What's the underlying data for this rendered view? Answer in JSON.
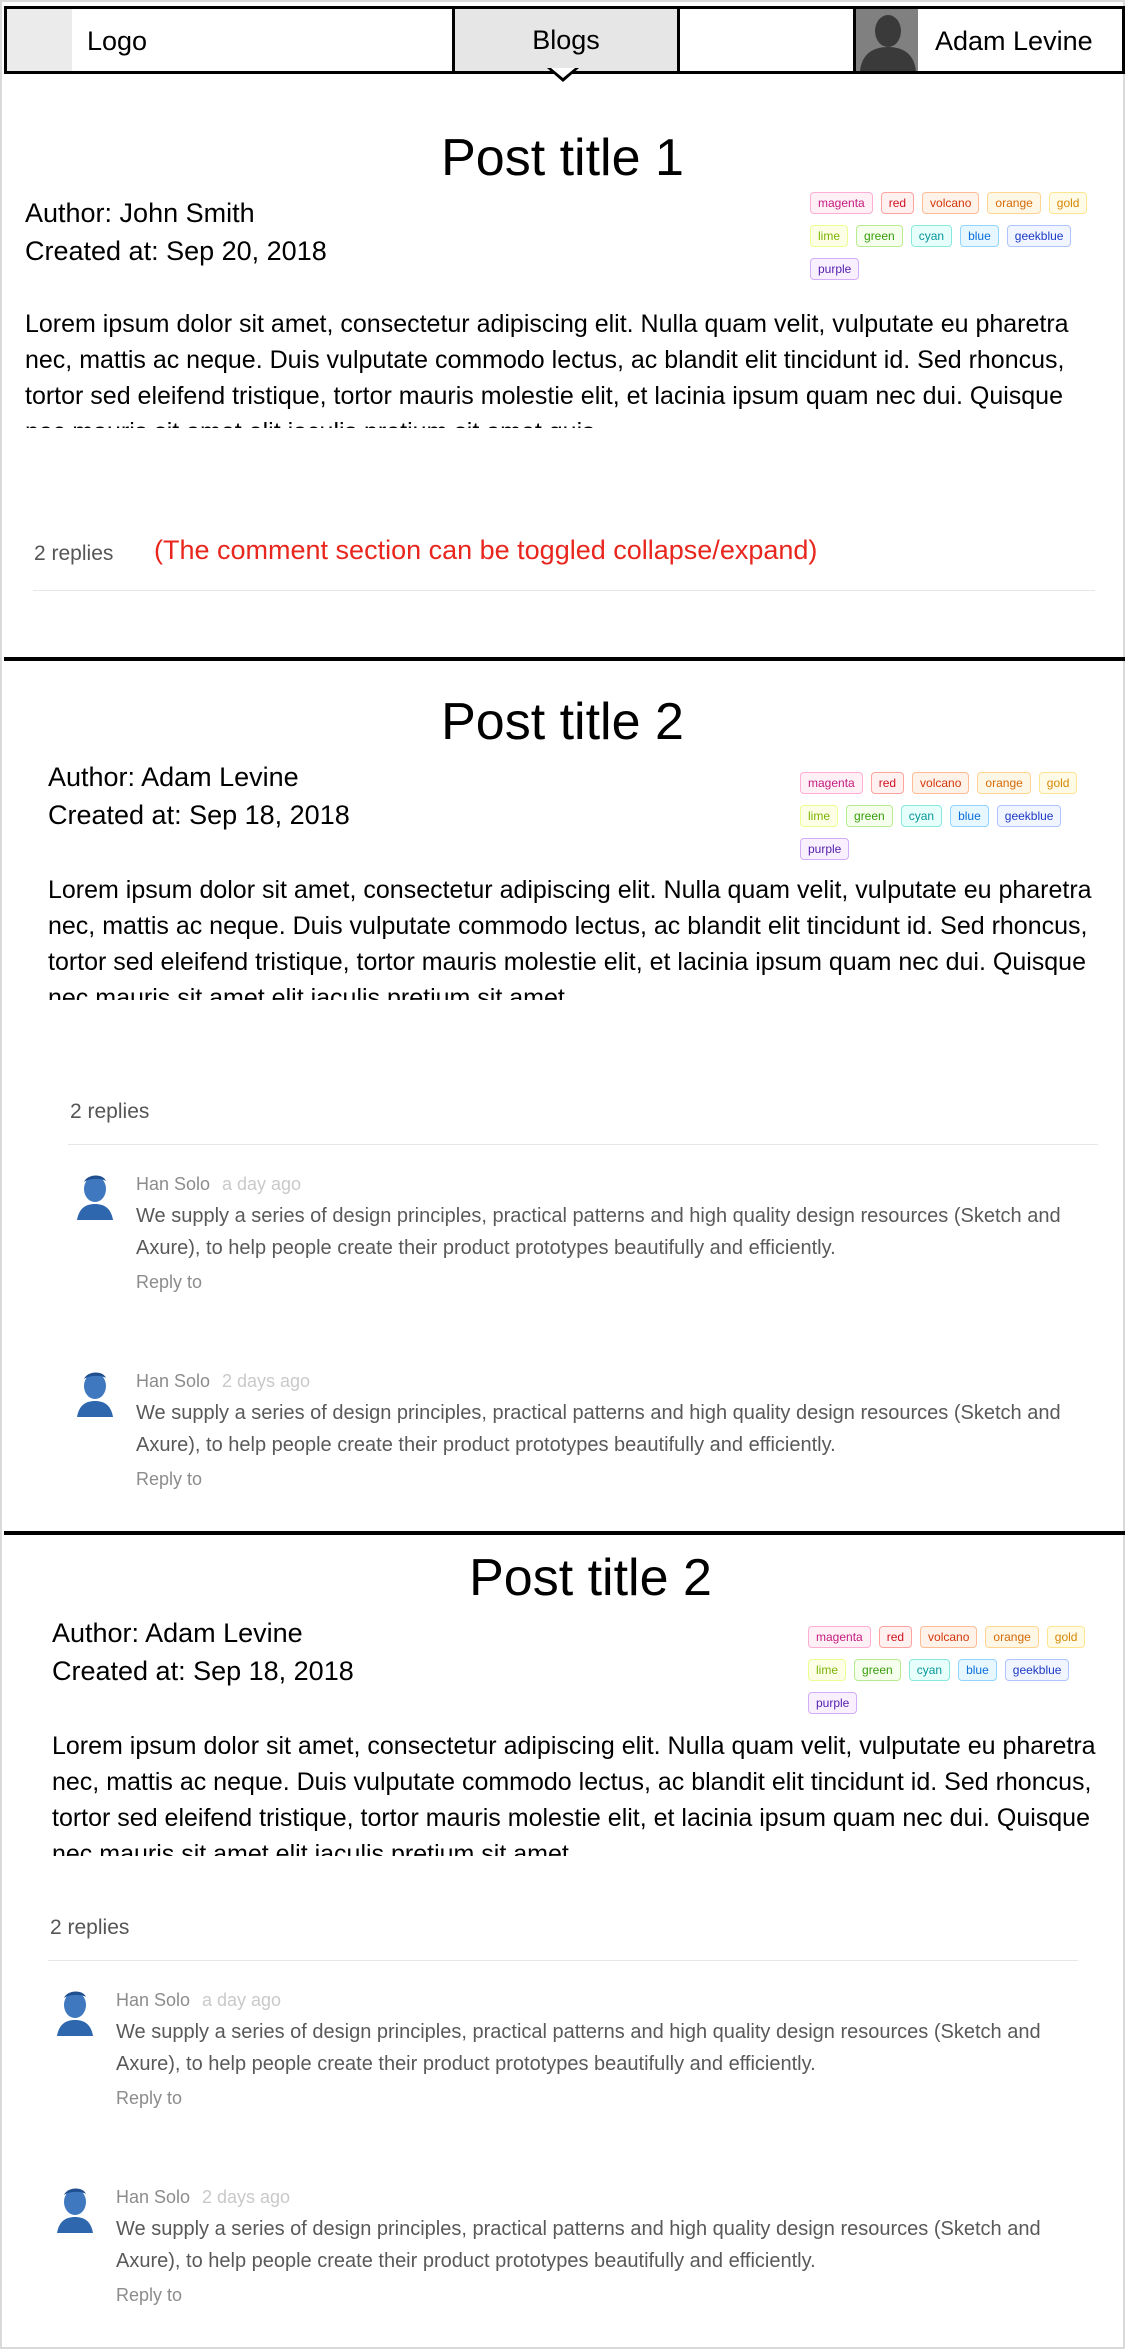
{
  "header": {
    "logo": "Logo",
    "nav_item": "Blogs",
    "user_name": "Adam Levine"
  },
  "tag_list": [
    {
      "label": "magenta",
      "color": "#c41d7f",
      "bg": "#fff0f6",
      "border": "#ffadd2"
    },
    {
      "label": "red",
      "color": "#cf1322",
      "bg": "#fff1f0",
      "border": "#ffa39e"
    },
    {
      "label": "volcano",
      "color": "#d4380d",
      "bg": "#fff2e8",
      "border": "#ffbb96"
    },
    {
      "label": "orange",
      "color": "#d46b08",
      "bg": "#fff7e6",
      "border": "#ffd591"
    },
    {
      "label": "gold",
      "color": "#d48806",
      "bg": "#fffbe6",
      "border": "#ffe58f"
    },
    {
      "label": "lime",
      "color": "#7cb305",
      "bg": "#fcffe6",
      "border": "#eaff8f"
    },
    {
      "label": "green",
      "color": "#389e0d",
      "bg": "#f6ffed",
      "border": "#b7eb8f"
    },
    {
      "label": "cyan",
      "color": "#08979c",
      "bg": "#e6fffb",
      "border": "#87e8de"
    },
    {
      "label": "blue",
      "color": "#096dd9",
      "bg": "#e6f7ff",
      "border": "#91d5ff"
    },
    {
      "label": "geekblue",
      "color": "#1d39c4",
      "bg": "#f0f5ff",
      "border": "#adc6ff"
    },
    {
      "label": "purple",
      "color": "#531dab",
      "bg": "#f9f0ff",
      "border": "#d3adf7"
    }
  ],
  "posts": [
    {
      "title": "Post title 1",
      "author": "Author: John Smith",
      "created": "Created at: Sep 20, 2018",
      "body": "Lorem ipsum dolor sit amet, consectetur adipiscing elit. Nulla quam velit, vulputate eu pharetra nec, mattis ac neque. Duis vulputate commodo lectus, ac blandit elit tincidunt id. Sed rhoncus, tortor sed eleifend tristique, tortor mauris molestie elit, et lacinia ipsum quam nec dui. Quisque nec mauris sit amet elit iaculis pretium sit amet quis",
      "replies": "2 replies",
      "note": "(The comment section can be toggled collapse/expand)"
    },
    {
      "title": "Post title 2",
      "author": "Author: Adam Levine",
      "created": "Created at: Sep 18, 2018",
      "body": "Lorem ipsum dolor sit amet, consectetur adipiscing elit. Nulla quam velit, vulputate eu pharetra nec, mattis ac neque. Duis vulputate commodo lectus, ac blandit elit tincidunt id. Sed rhoncus, tortor sed eleifend tristique, tortor mauris molestie elit, et lacinia ipsum quam nec dui. Quisque nec mauris sit amet elit iaculis pretium sit amet",
      "replies": "2 replies",
      "comments": [
        {
          "author": "Han Solo",
          "time": "a day ago",
          "text": "We supply a series of design principles, practical patterns and high quality design resources (Sketch and Axure), to help people create their product prototypes beautifully and efficiently.",
          "reply": "Reply to"
        },
        {
          "author": "Han Solo",
          "time": "2 days ago",
          "text": "We supply a series of design principles, practical patterns and high quality design resources (Sketch and Axure), to help people create their product prototypes beautifully and efficiently.",
          "reply": "Reply to"
        }
      ]
    },
    {
      "title": "Post title 2",
      "author": "Author: Adam Levine",
      "created": "Created at: Sep 18, 2018",
      "body": "Lorem ipsum dolor sit amet, consectetur adipiscing elit. Nulla quam velit, vulputate eu pharetra nec, mattis ac neque. Duis vulputate commodo lectus, ac blandit elit tincidunt id. Sed rhoncus, tortor sed eleifend tristique, tortor mauris molestie elit, et lacinia ipsum quam nec dui. Quisque nec mauris sit amet elit iaculis pretium sit amet",
      "replies": "2 replies",
      "comments": [
        {
          "author": "Han Solo",
          "time": "a day ago",
          "text": "We supply a series of design principles, practical patterns and high quality design resources (Sketch and Axure), to help people create their product prototypes beautifully and efficiently.",
          "reply": "Reply to"
        },
        {
          "author": "Han Solo",
          "time": "2 days ago",
          "text": "We supply a series of design principles, practical patterns and high quality design resources (Sketch and Axure), to help people create their product prototypes beautifully and efficiently.",
          "reply": "Reply to"
        }
      ]
    }
  ]
}
